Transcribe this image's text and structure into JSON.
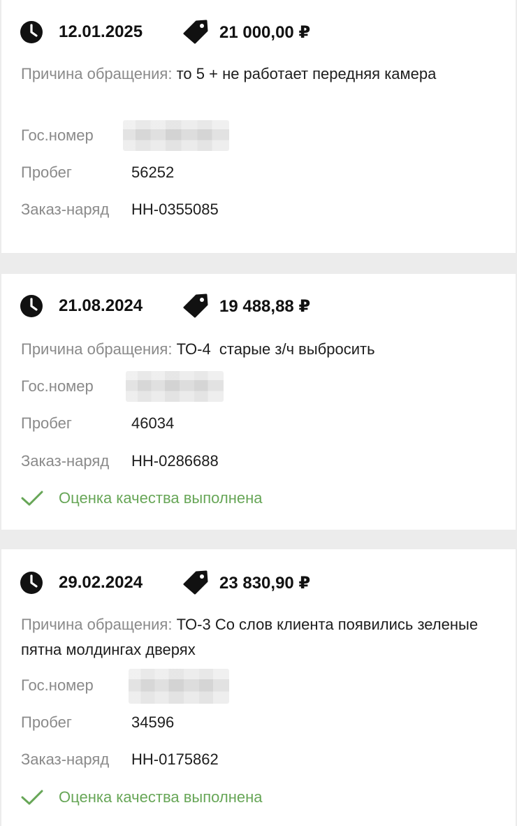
{
  "labels": {
    "reason": "Причина обращения:",
    "plate": "Гос.номер",
    "mileage": "Пробег",
    "order": "Заказ-наряд",
    "quality_done": "Оценка качества выполнена"
  },
  "icons": {
    "date": "clock-icon",
    "price": "price-tag-icon",
    "quality": "checkmark-icon"
  },
  "colors": {
    "quality_green": "#67a657",
    "label_gray": "#8a8a8a"
  },
  "visits": [
    {
      "date": "12.01.2025",
      "price": "21 000,00 ₽",
      "reason": "то 5 + не работает передняя камера",
      "plate": "",
      "mileage": "56252",
      "order": "НН-0355085",
      "quality_rated": false
    },
    {
      "date": "21.08.2024",
      "price": "19 488,88 ₽",
      "reason": "ТО-4  старые з/ч выбросить",
      "plate": "",
      "mileage": "46034",
      "order": "НН-0286688",
      "quality_rated": true
    },
    {
      "date": "29.02.2024",
      "price": "23 830,90 ₽",
      "reason": "ТО-3 Со слов клиента появились зеленые пятна молдингах дверях",
      "plate": "",
      "mileage": "34596",
      "order": "НН-0175862",
      "quality_rated": true
    }
  ]
}
